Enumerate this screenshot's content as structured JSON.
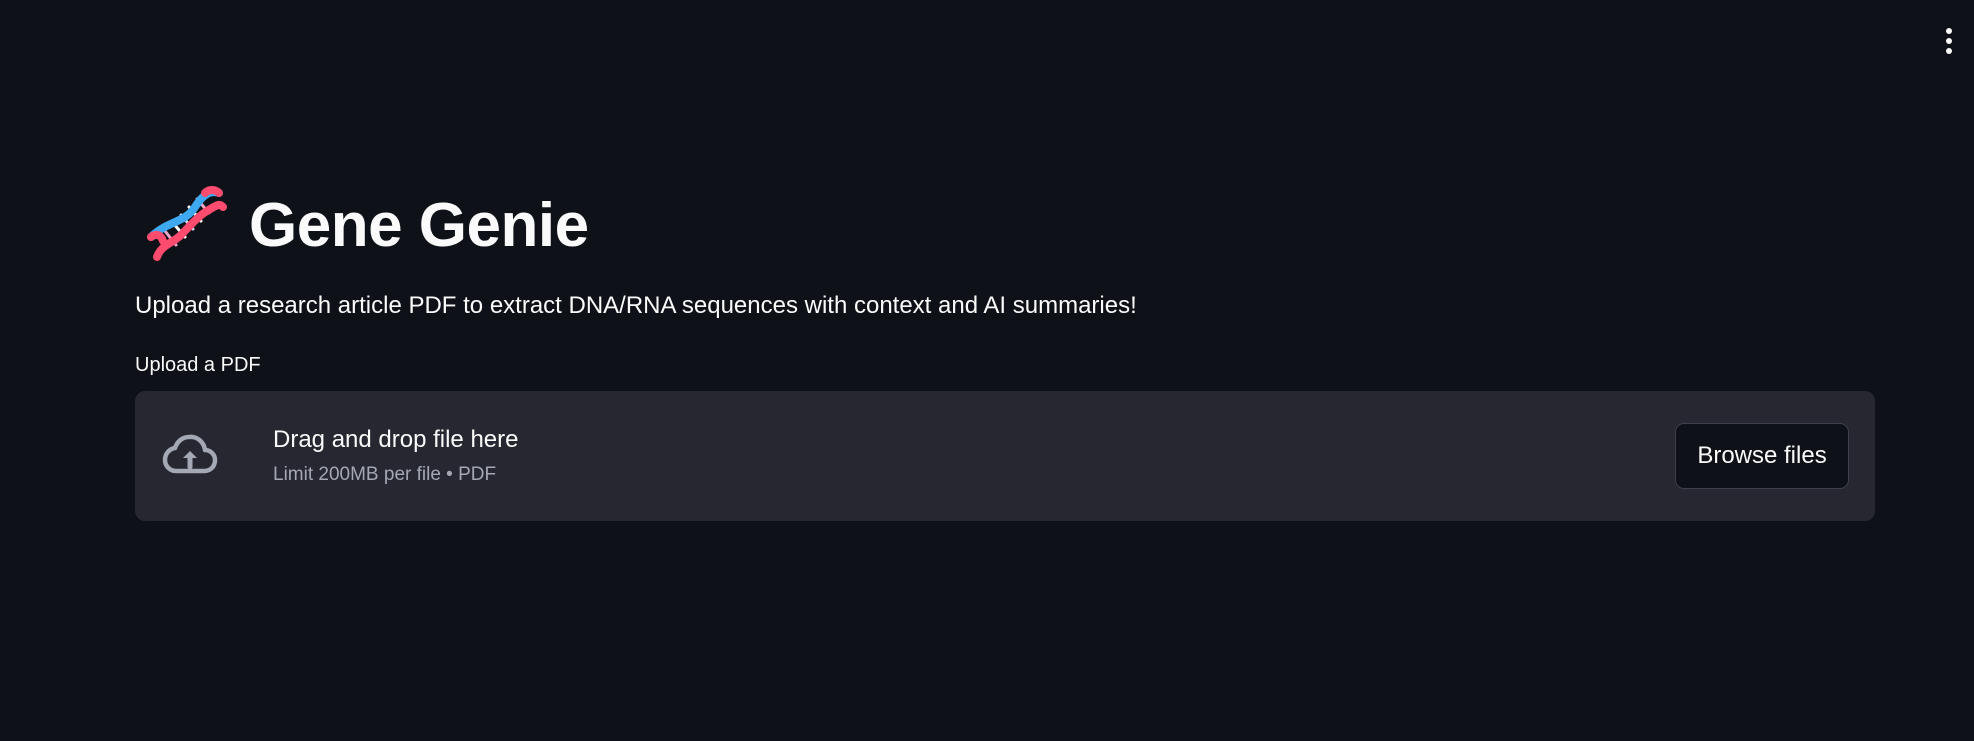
{
  "app": {
    "title": "Gene Genie",
    "description": "Upload a research article PDF to extract DNA/RNA sequences with context and AI summaries!"
  },
  "uploader": {
    "label": "Upload a PDF",
    "drop_text": "Drag and drop file here",
    "limit_text": "Limit 200MB per file • PDF",
    "browse_label": "Browse files"
  },
  "icons": {
    "title_icon": "dna-icon",
    "upload_icon": "cloud-upload-icon",
    "menu_icon": "kebab-menu-icon"
  },
  "colors": {
    "background": "#0e1117",
    "dropzone": "#262730",
    "text": "#fafafa",
    "muted_text": "#a3a8b4",
    "dna_red": "#ff4b6e",
    "dna_blue": "#3ea8f0"
  }
}
